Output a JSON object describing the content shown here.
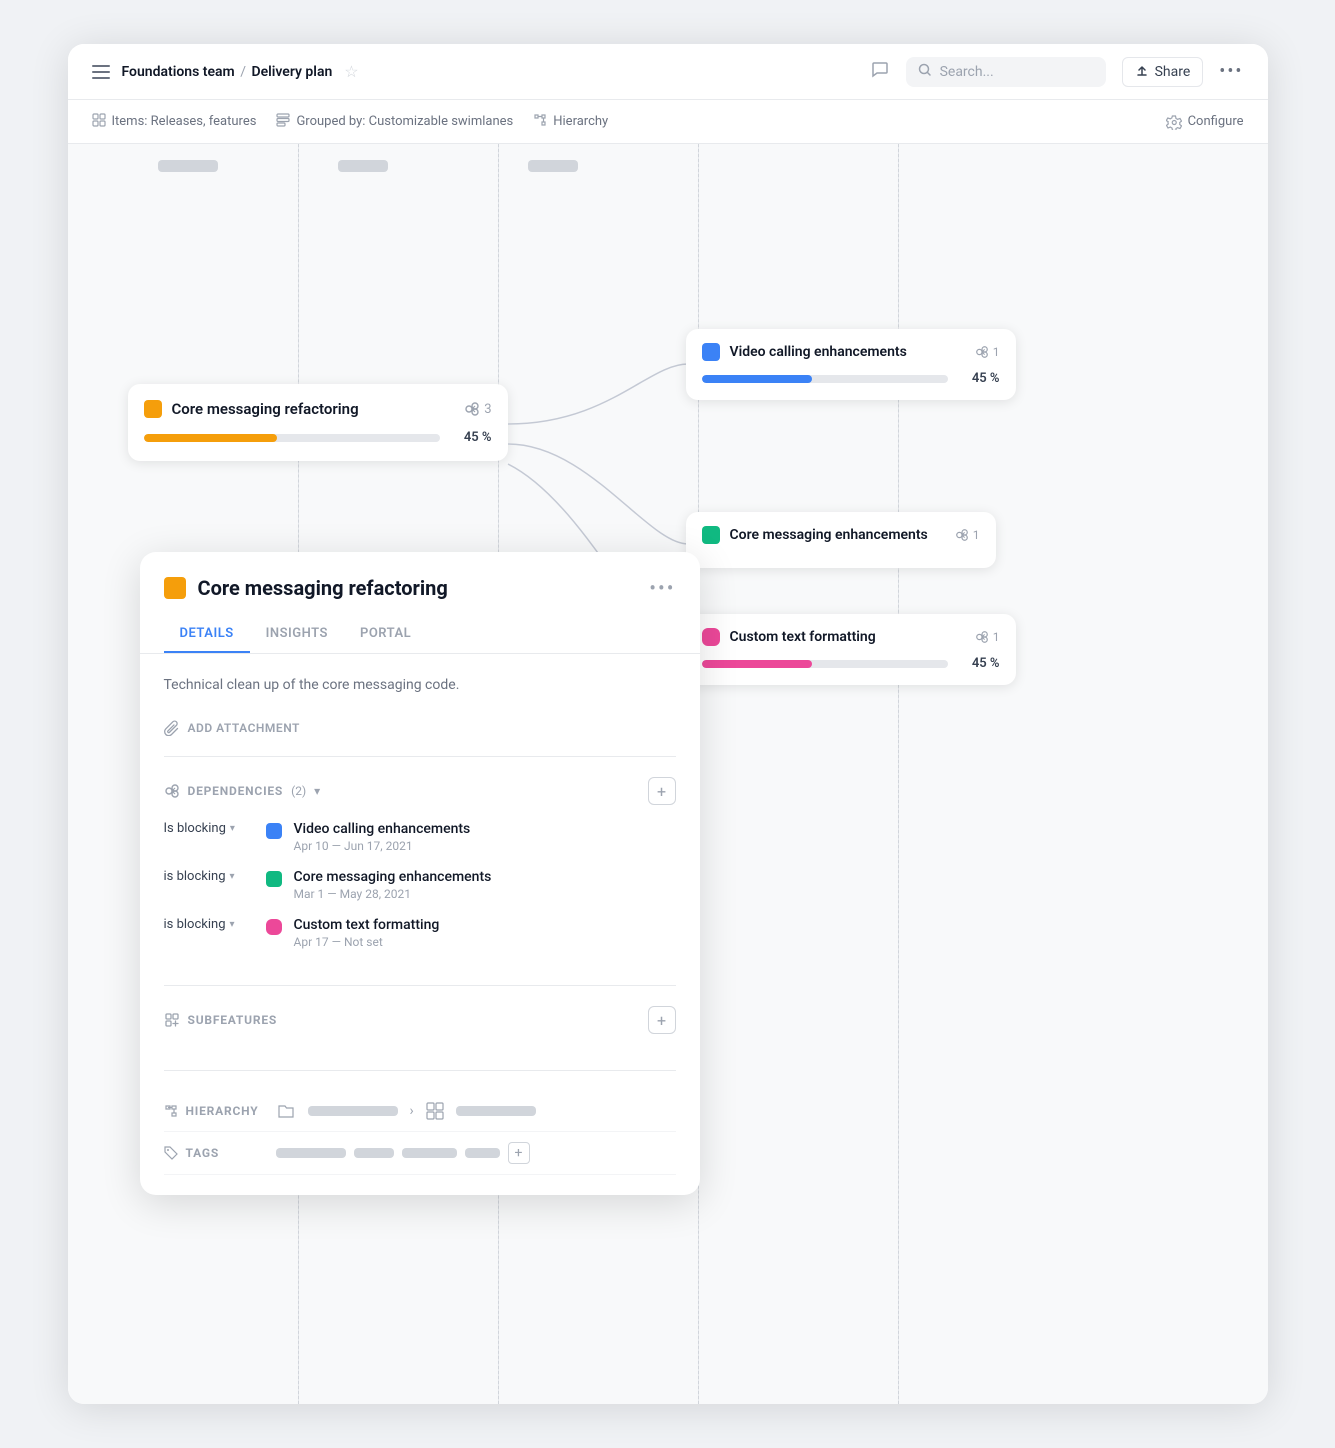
{
  "header": {
    "menu_label": "menu",
    "breadcrumb": {
      "team": "Foundations team",
      "separator": "/",
      "plan": "Delivery plan"
    },
    "star_label": "favorite",
    "comment_label": "comments",
    "search_placeholder": "Search...",
    "share_label": "Share",
    "more_label": "more"
  },
  "toolbar": {
    "items_label": "Items: Releases, features",
    "grouped_label": "Grouped by: Customizable swimlanes",
    "hierarchy_label": "Hierarchy",
    "configure_label": "Configure"
  },
  "canvas": {
    "main_card": {
      "title": "Core messaging refactoring",
      "color": "#f59e0b",
      "deps_count": "3",
      "progress": 45,
      "progress_label": "45 %",
      "progress_color": "#f59e0b"
    },
    "right_cards": [
      {
        "id": "video",
        "title": "Video calling enhancements",
        "color": "#3b82f6",
        "deps_count": "1",
        "progress": 45,
        "progress_label": "45 %",
        "progress_color": "#3b82f6"
      },
      {
        "id": "core-messaging",
        "title": "Core messaging enhancements",
        "color": "#10b981",
        "deps_count": "1",
        "progress": null
      },
      {
        "id": "custom-text",
        "title": "Custom text formatting",
        "color": "#ec4899",
        "deps_count": "1",
        "progress": 45,
        "progress_label": "45 %",
        "progress_color": "#ec4899"
      }
    ]
  },
  "detail_panel": {
    "title": "Core messaging refactoring",
    "color": "#f59e0b",
    "more_label": "more",
    "tabs": [
      {
        "id": "details",
        "label": "DETAILS",
        "active": true
      },
      {
        "id": "insights",
        "label": "INSIGHTS",
        "active": false
      },
      {
        "id": "portal",
        "label": "PORTAL",
        "active": false
      }
    ],
    "description": "Technical clean up of the core messaging code.",
    "add_attachment_label": "ADD ATTACHMENT",
    "dependencies": {
      "title": "DEPENDENCIES",
      "count": "(2)",
      "items": [
        {
          "relation": "Is blocking",
          "color": "#3b82f6",
          "name": "Video calling enhancements",
          "date_start": "Apr 10",
          "date_end": "Jun 17, 2021"
        },
        {
          "relation": "is blocking",
          "color": "#10b981",
          "name": "Core messaging enhancements",
          "date_start": "Mar 1",
          "date_end": "May 28, 2021"
        },
        {
          "relation": "is blocking",
          "color": "#ec4899",
          "name": "Custom text formatting",
          "date_start": "Apr 17",
          "date_end": "Not set"
        }
      ]
    },
    "subfeatures": {
      "title": "SUBFEATURES"
    },
    "hierarchy": {
      "label": "HIERARCHY"
    },
    "tags": {
      "label": "TAGS"
    }
  },
  "icons": {
    "menu": "☰",
    "star": "☆",
    "comment": "💬",
    "search": "🔍",
    "share": "↑",
    "more": "•••",
    "items": "⊞",
    "grouped": "⊟",
    "hierarchy_icon": "⊠",
    "configure": "⚙",
    "dependency": "⊛",
    "attachment": "⊙",
    "chevron_down": "▾",
    "plus": "+",
    "arrow_right": ">",
    "dash": "—"
  }
}
